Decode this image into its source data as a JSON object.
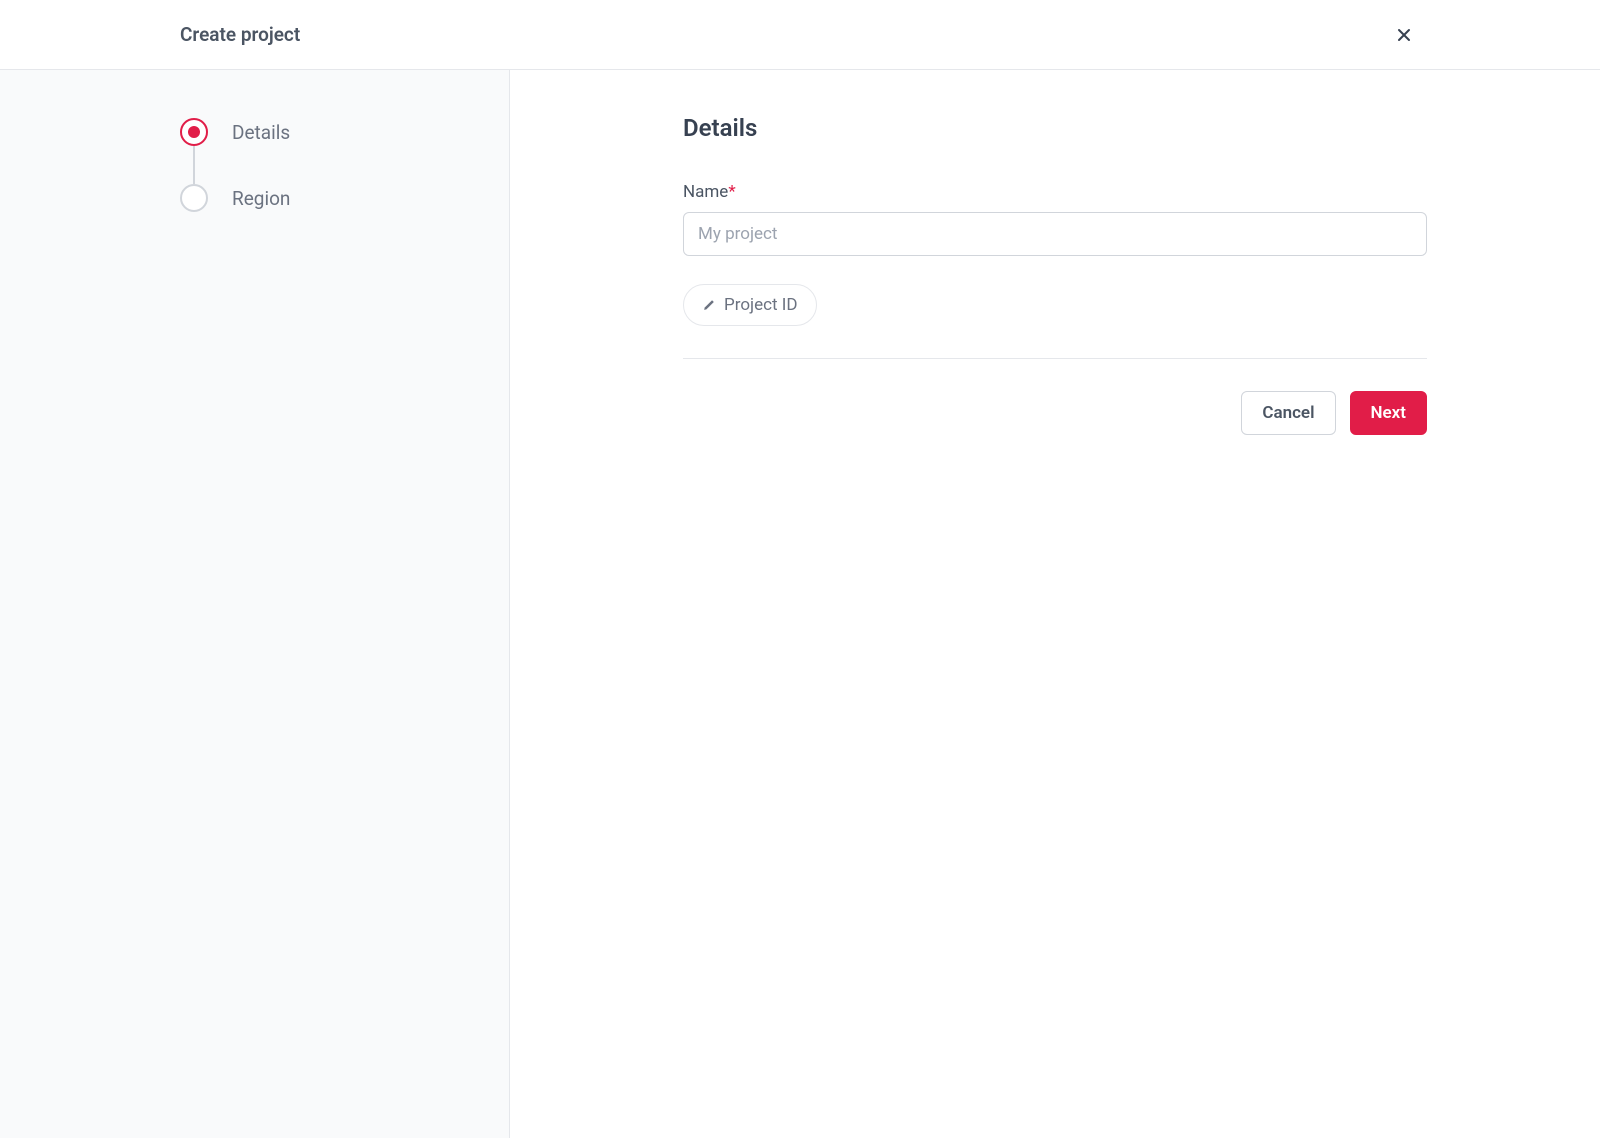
{
  "header": {
    "title": "Create project"
  },
  "sidebar": {
    "steps": [
      {
        "label": "Details",
        "active": true
      },
      {
        "label": "Region",
        "active": false
      }
    ]
  },
  "main": {
    "section_title": "Details",
    "name_field": {
      "label": "Name",
      "required_mark": "*",
      "placeholder": "My project",
      "value": ""
    },
    "project_id_button": "Project ID",
    "actions": {
      "cancel": "Cancel",
      "next": "Next"
    }
  },
  "colors": {
    "accent": "#e11d48",
    "border": "#e5e7eb",
    "text_primary": "#374151",
    "text_secondary": "#6b7280",
    "sidebar_bg": "#f9fafb"
  }
}
